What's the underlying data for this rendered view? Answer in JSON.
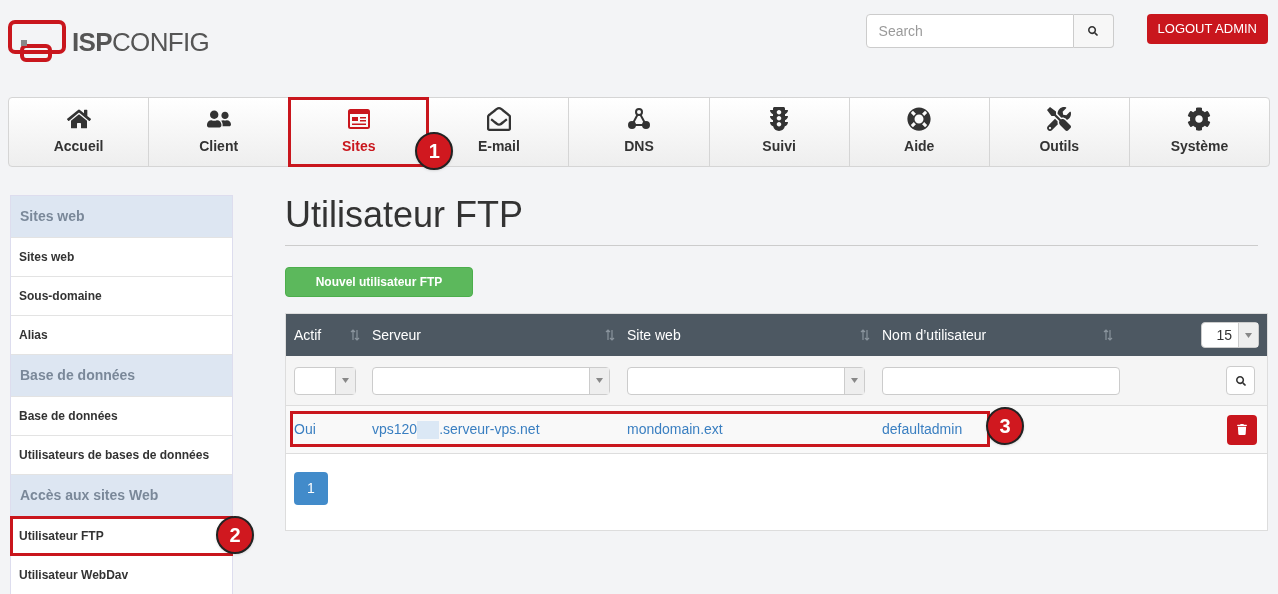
{
  "logo": {
    "part_bold": "ISP",
    "part_light": "CONFIG"
  },
  "search": {
    "placeholder": "Search"
  },
  "logout_button": "LOGOUT ADMIN",
  "nav_tabs": [
    {
      "label": "Accueil",
      "selected": false
    },
    {
      "label": "Client",
      "selected": false
    },
    {
      "label": "Sites",
      "selected": true,
      "marker": "1"
    },
    {
      "label": "E-mail",
      "selected": false
    },
    {
      "label": "DNS",
      "selected": false
    },
    {
      "label": "Suivi",
      "selected": false
    },
    {
      "label": "Aide",
      "selected": false
    },
    {
      "label": "Outils",
      "selected": false
    },
    {
      "label": "Système",
      "selected": false
    }
  ],
  "sidebar": [
    {
      "heading": "Sites web",
      "items": [
        {
          "label": "Sites web",
          "selected": false
        },
        {
          "label": "Sous-domaine",
          "selected": false
        },
        {
          "label": "Alias",
          "selected": false
        }
      ]
    },
    {
      "heading": "Base de données",
      "items": [
        {
          "label": "Base de données",
          "selected": false
        },
        {
          "label": "Utilisateurs de bases de données",
          "selected": false
        }
      ]
    },
    {
      "heading": "Accès aux sites Web",
      "items": [
        {
          "label": "Utilisateur FTP",
          "selected": true,
          "marker": "2"
        },
        {
          "label": "Utilisateur WebDav",
          "selected": false
        }
      ]
    }
  ],
  "page_title": "Utilisateur FTP",
  "new_button": "Nouvel utilisateur FTP",
  "table": {
    "columns": [
      "Actif",
      "Serveur",
      "Site web",
      "Nom d’utilisateur"
    ],
    "page_size": "15",
    "rows": [
      {
        "active": "Oui",
        "server_parts": [
          "vps120",
          ".serveur-vps.net"
        ],
        "site": "mondomain.ext",
        "username": "defaultadmin",
        "marker": "3"
      }
    ]
  },
  "pagination": [
    {
      "label": "1",
      "selected": true
    }
  ]
}
